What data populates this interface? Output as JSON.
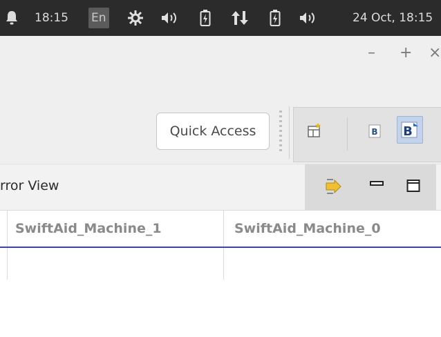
{
  "topbar": {
    "clock": "18:15",
    "language": "En",
    "datetime": "24 Oct, 18:15"
  },
  "window": {
    "minimize": "–",
    "maximize": "+",
    "close": "×"
  },
  "toolbar": {
    "quick_access": "Quick Access"
  },
  "view": {
    "title": "rror View"
  },
  "table": {
    "columns": [
      "SwiftAid_Machine_1",
      "SwiftAid_Machine_0"
    ],
    "rows": []
  },
  "colors": {
    "panel_bg": "#2b2b2b",
    "header_underline": "#3b3bd6",
    "active_perspective": "#c3d3ec"
  }
}
